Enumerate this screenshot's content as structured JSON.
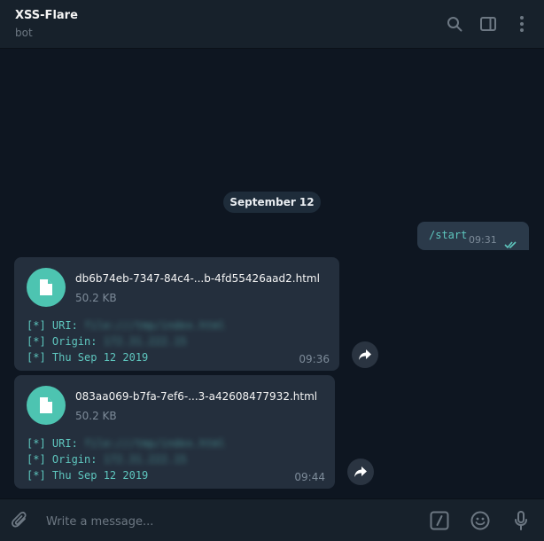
{
  "header": {
    "title": "XSS-Flare",
    "subtitle": "bot",
    "icons": [
      "search-icon",
      "sidebar-toggle-icon",
      "more-vertical-icon"
    ]
  },
  "date_separator": "September 12",
  "outgoing": {
    "text": "/start",
    "time": "09:31",
    "status_icon": "double-check-icon"
  },
  "messages": [
    {
      "file_name": "db6b74eb-7347-84c4-...b-4fd55426aad2.html",
      "file_size": "50.2 KB",
      "lines": [
        {
          "prefix": "[*] URI:",
          "value": "file:///tmp/index.html"
        },
        {
          "prefix": "[*] Origin:",
          "value": "172.31.222.15"
        },
        {
          "prefix": "[*] Thu Sep 12 2019",
          "value": ""
        }
      ],
      "time": "09:36"
    },
    {
      "file_name": "083aa069-b7fa-7ef6-...3-a42608477932.html",
      "file_size": "50.2 KB",
      "lines": [
        {
          "prefix": "[*] URI:",
          "value": "file:///tmp/index.html"
        },
        {
          "prefix": "[*] Origin:",
          "value": "172.31.222.15"
        },
        {
          "prefix": "[*] Thu Sep 12 2019",
          "value": ""
        }
      ],
      "time": "09:44"
    }
  ],
  "composer": {
    "placeholder": "Write a message...",
    "icons": [
      "attach-icon",
      "bot-commands-icon",
      "emoji-icon",
      "microphone-icon"
    ]
  },
  "colors": {
    "background": "#0e1621",
    "header": "#17212b",
    "bubble": "#242f3d",
    "accent": "#5ec6be",
    "file_icon": "#4dc4b1"
  }
}
